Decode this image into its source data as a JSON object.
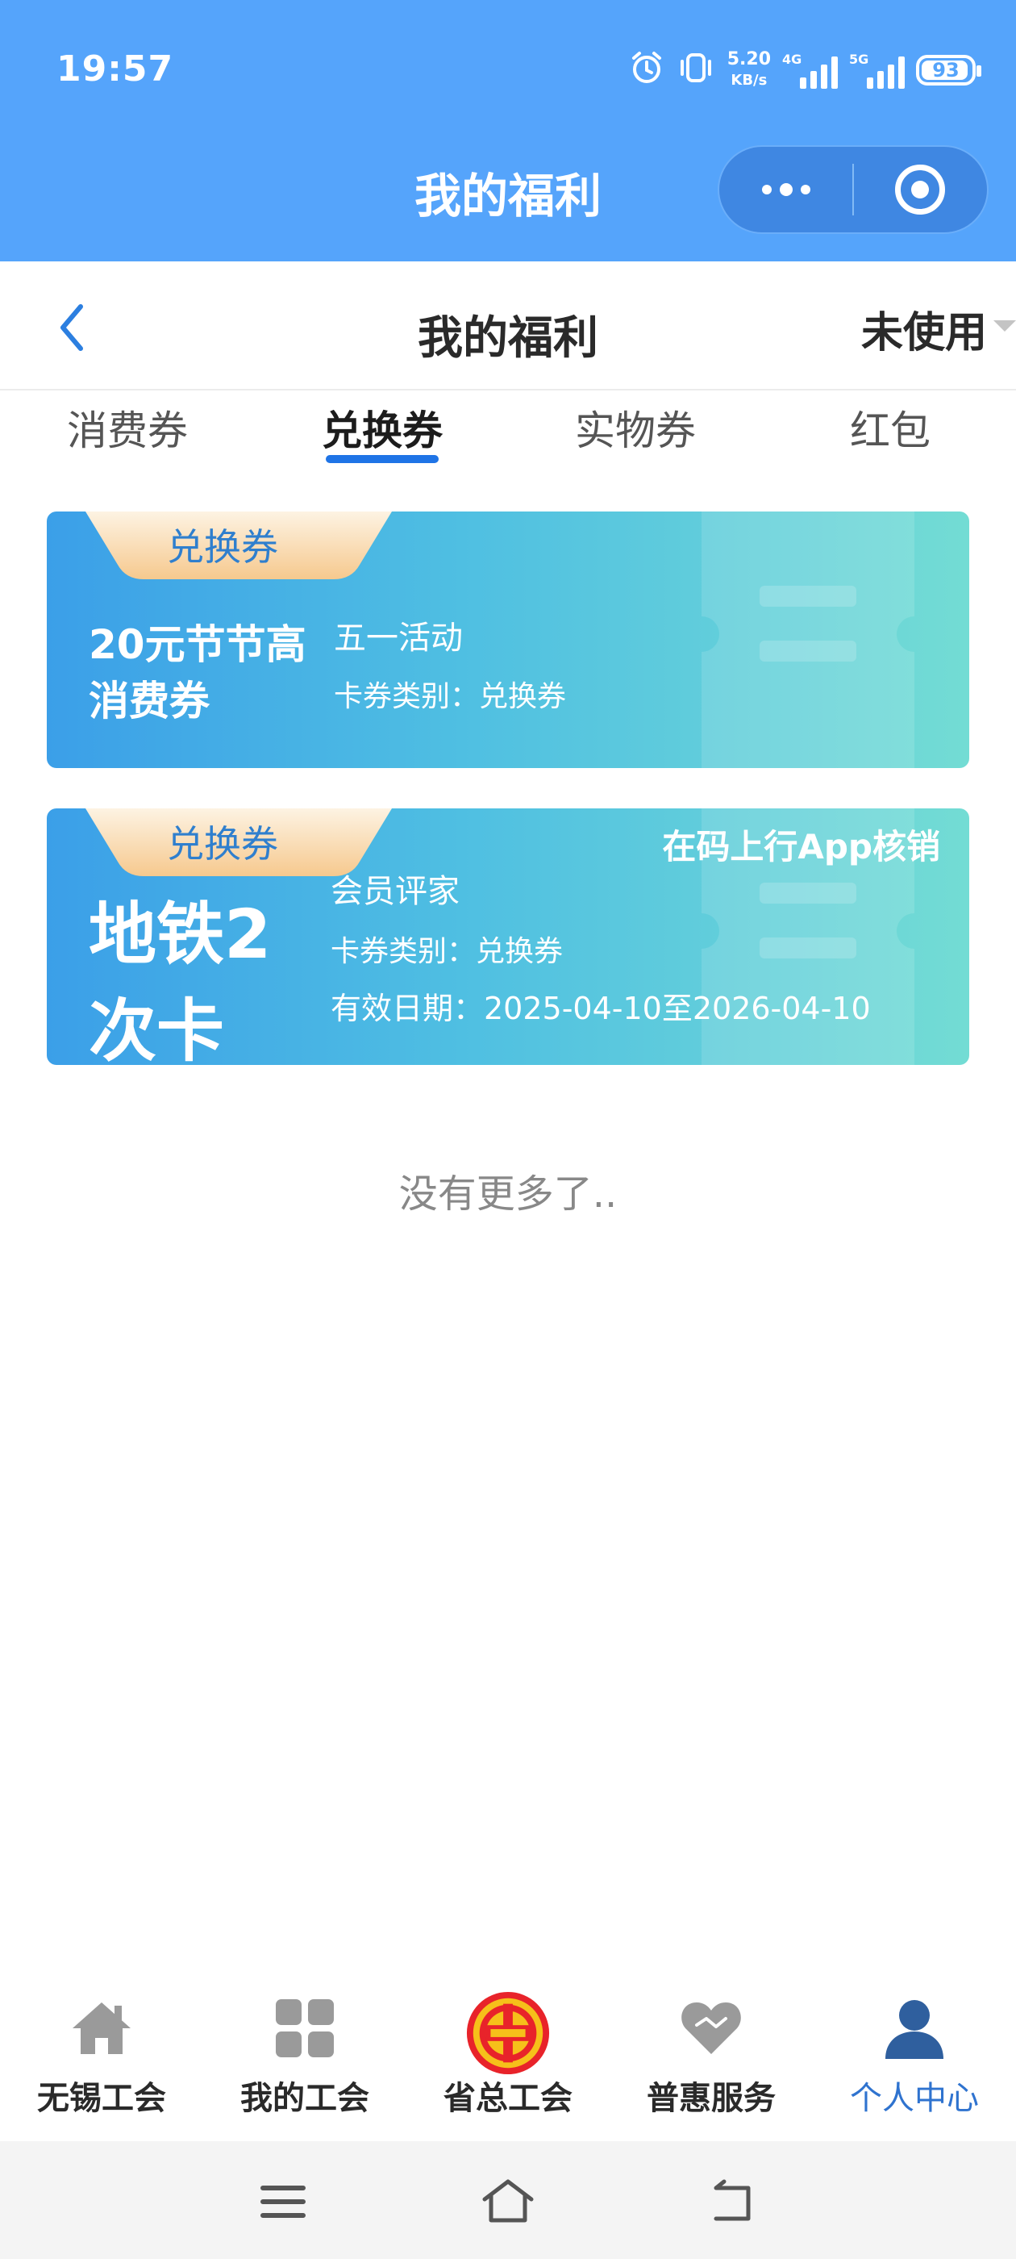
{
  "status_bar": {
    "time": "19:57",
    "net_speed": "5.20",
    "net_speed_unit": "KB/s",
    "signal_1": "4G",
    "signal_2": "5G",
    "battery": "93"
  },
  "mini_program": {
    "title": "我的福利"
  },
  "navbar": {
    "title": "我的福利",
    "filter": "未使用"
  },
  "tabs": [
    {
      "label": "消费券",
      "active": false
    },
    {
      "label": "兑换券",
      "active": true
    },
    {
      "label": "实物券",
      "active": false
    },
    {
      "label": "红包",
      "active": false
    }
  ],
  "coupons": [
    {
      "tag": "兑换券",
      "name": "20元节节高消费券",
      "title": "五一活动",
      "category": "卡券类别：兑换券"
    },
    {
      "tag": "兑换券",
      "name": "地铁2次卡",
      "title": "会员评家",
      "category": "卡券类别：兑换券",
      "validity": "有效日期：2025-04-10至2026-04-10",
      "note": "在码上行App核销"
    }
  ],
  "list_end": "没有更多了..",
  "bottom_tabs": [
    {
      "label": "无锡工会",
      "icon": "home-icon",
      "active": false
    },
    {
      "label": "我的工会",
      "icon": "grid-icon",
      "active": false
    },
    {
      "label": "省总工会",
      "icon": "union-emblem-icon",
      "active": false
    },
    {
      "label": "普惠服务",
      "icon": "heart-icon",
      "active": false
    },
    {
      "label": "个人中心",
      "icon": "person-icon",
      "active": true
    }
  ],
  "colors": {
    "header_blue": "#55a4fb",
    "accent": "#1f74e6",
    "active_tab_text": "#2f73cf"
  }
}
